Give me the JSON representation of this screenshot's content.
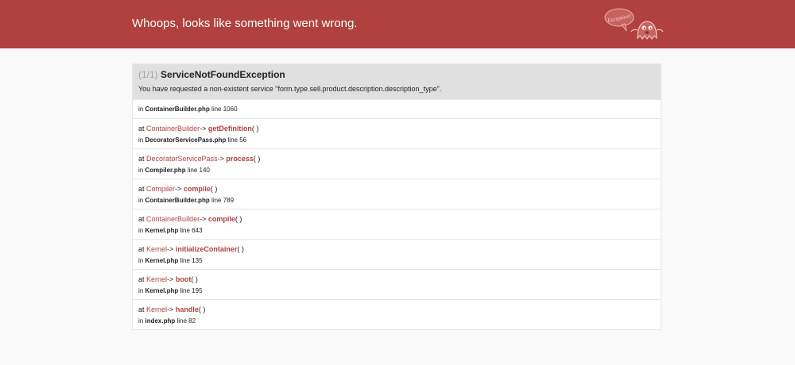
{
  "header": {
    "title": "Whoops, looks like something went wrong.",
    "logo_text": "Exception!"
  },
  "exception": {
    "count": "(1/1)",
    "name": "ServiceNotFoundException",
    "message": "You have requested a non-existent service \"form.type.sell.product.description.description_type\"."
  },
  "labels": {
    "in": "in",
    "at": "at",
    "line": "line",
    "arrow": "->",
    "parens": "( )"
  },
  "colors": {
    "accent": "#b0413e",
    "header_bg": "#b0413e",
    "page_bg": "#f9f9f9",
    "panel_head_bg": "#e0e0e0"
  },
  "trace": [
    {
      "file": "ContainerBuilder.php",
      "line": "1060"
    },
    {
      "class": "ContainerBuilder",
      "method": "getDefinition",
      "file": "DecoratorServicePass.php",
      "line": "56"
    },
    {
      "class": "DecoratorServicePass",
      "method": "process",
      "file": "Compiler.php",
      "line": "140"
    },
    {
      "class": "Compiler",
      "method": "compile",
      "file": "ContainerBuilder.php",
      "line": "789"
    },
    {
      "class": "ContainerBuilder",
      "method": "compile",
      "file": "Kernel.php",
      "line": "643"
    },
    {
      "class": "Kernel",
      "method": "initializeContainer",
      "file": "Kernel.php",
      "line": "135"
    },
    {
      "class": "Kernel",
      "method": "boot",
      "file": "Kernel.php",
      "line": "195"
    },
    {
      "class": "Kernel",
      "method": "handle",
      "file": "index.php",
      "line": "82"
    }
  ]
}
